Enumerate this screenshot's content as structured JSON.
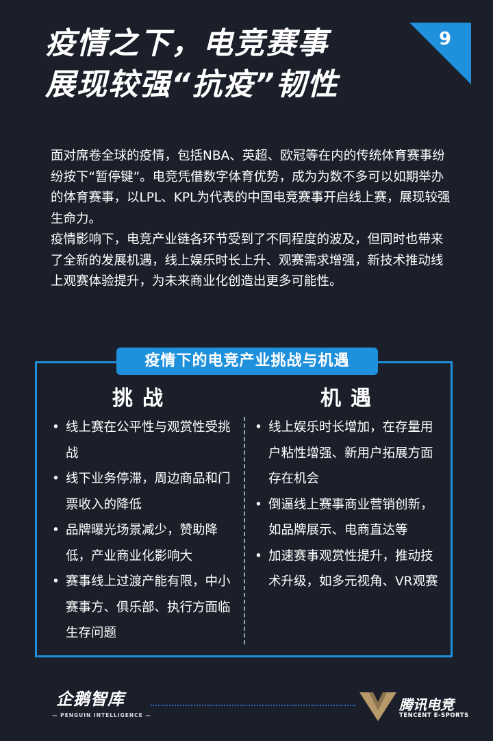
{
  "header": {
    "title_line1": "疫情之下，电竞赛事",
    "title_line2": "展现较强“抗疫”韧性",
    "page_number": "9"
  },
  "intro": {
    "paragraph1": "面对席卷全球的疫情，包括NBA、英超、欧冠等在内的传统体育赛事纷纷按下“暂停键”。电竞凭借数字体育优势，成为为数不多可以如期举办的体育赛事，以LPL、KPL为代表的中国电竞赛事开启线上赛，展现较强生命力。",
    "paragraph2": "疫情影响下，电竞产业链各环节受到了不同程度的波及，但同时也带来了全新的发展机遇，线上娱乐时长上升、观赛需求增强，新技术推动线上观赛体验提升，为未来商业化创造出更多可能性。"
  },
  "panel": {
    "title": "疫情下的电竞产业挑战与机遇",
    "challenges": {
      "heading": "挑战",
      "items": [
        "线上赛在公平性与观赏性受挑战",
        "线下业务停滞，周边商品和门票收入的降低",
        "品牌曝光场景减少，赞助降低，产业商业化影响大",
        "赛事线上过渡产能有限，中小赛事方、俱乐部、执行方面临生存问题"
      ]
    },
    "opportunities": {
      "heading": "机遇",
      "items": [
        "线上娱乐时长增加，在存量用户粘性增强、新用户拓展方面存在机会",
        "倒逼线上赛事商业营销创新，如品牌展示、电商直达等",
        "加速赛事观赏性提升，推动技术升级，如多元视角、VR观赛"
      ]
    }
  },
  "footer": {
    "left_logo_name": "企鹅智库",
    "left_logo_en": "— PENGUIN INTELLIGENCE —",
    "right_logo_name": "腾讯电竞",
    "right_logo_en": "TENCENT E-SPORTS"
  },
  "colors": {
    "background": "#1b1f2a",
    "accent_blue": "#1f90dc",
    "text": "#ffffff",
    "gold": "#b89a6a"
  }
}
